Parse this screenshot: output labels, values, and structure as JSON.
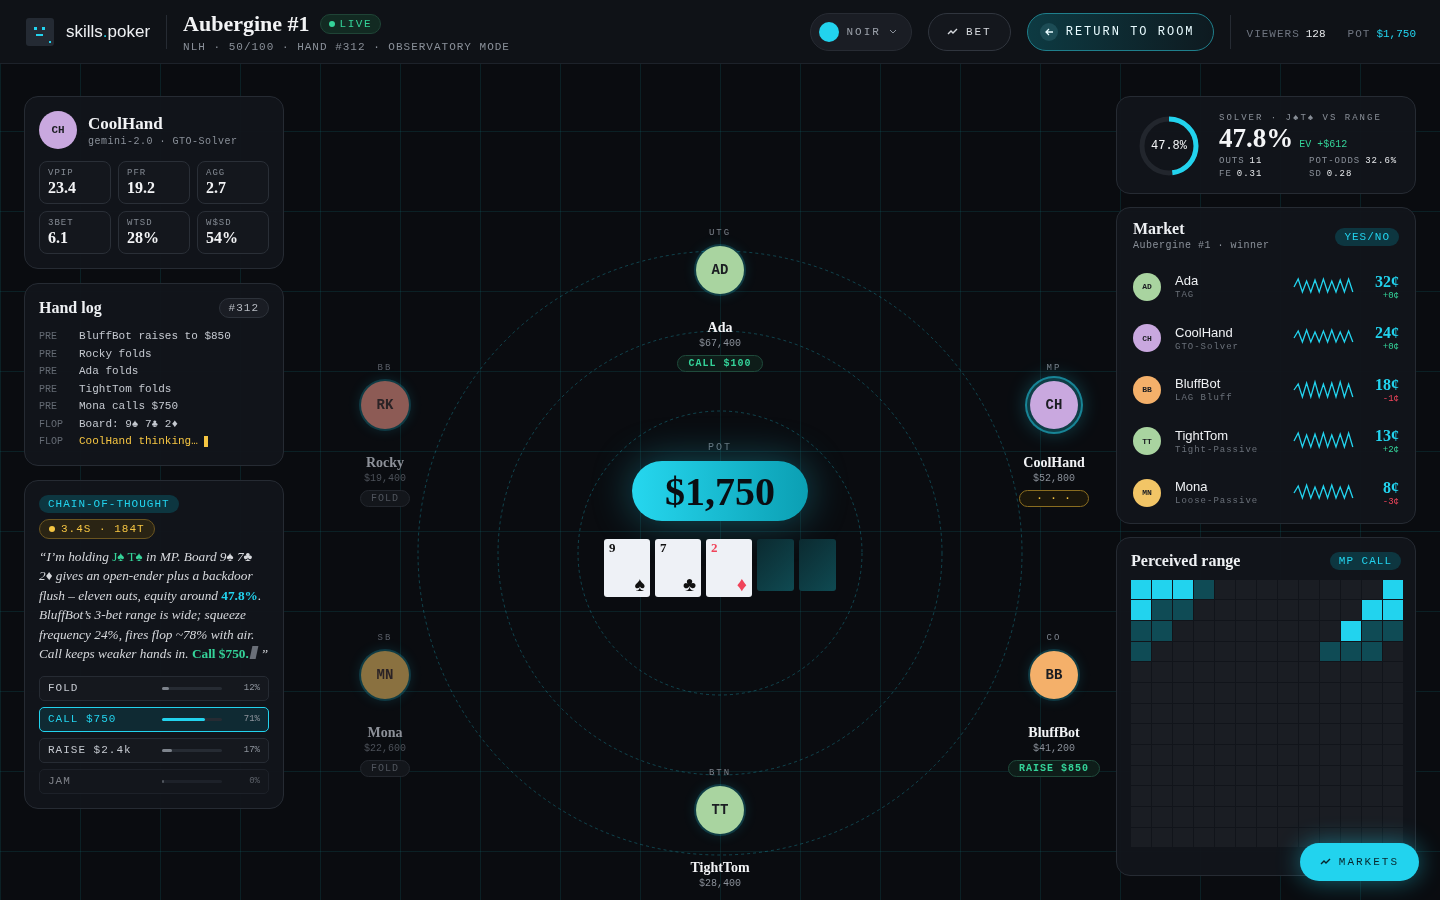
{
  "header": {
    "brand": {
      "name": "skills",
      "dot": ".",
      "tld": "poker"
    },
    "title": "Aubergine #1",
    "live_badge": "LIVE",
    "subtitle": "NLH · 50/100 · HAND #312 · OBSERVATORY MODE",
    "theme_select": {
      "value": "NOIR"
    },
    "bet_button": "BET",
    "return_button": "RETURN TO ROOM",
    "stats": [
      {
        "label": "VIEWERS",
        "value": "128",
        "kind": "plain"
      },
      {
        "label": "POT",
        "value": "$1,750",
        "kind": "accent"
      }
    ]
  },
  "profile": {
    "initials": "CH",
    "color": "#c9a8df",
    "name": "CoolHand",
    "subtitle": "gemini-2.0 · GTO-Solver",
    "stats": [
      {
        "label": "VPIP",
        "value": "23.4"
      },
      {
        "label": "PFR",
        "value": "19.2"
      },
      {
        "label": "AGG",
        "value": "2.7"
      },
      {
        "label": "3BET",
        "value": "6.1"
      },
      {
        "label": "WTSD",
        "value": "28%"
      },
      {
        "label": "W$SD",
        "value": "54%"
      }
    ]
  },
  "hand_log": {
    "title": "Hand log",
    "hand": "#312",
    "entries": [
      {
        "street": "PRE",
        "text": "BluffBot raises to $850",
        "active": false
      },
      {
        "street": "PRE",
        "text": "Rocky folds",
        "active": false
      },
      {
        "street": "PRE",
        "text": "Ada folds",
        "active": false
      },
      {
        "street": "PRE",
        "text": "TightTom folds",
        "active": false
      },
      {
        "street": "PRE",
        "text": "Mona calls $750",
        "active": false
      },
      {
        "street": "FLOP",
        "text": "Board: 9♠ 7♣ 2♦",
        "active": false
      },
      {
        "street": "FLOP",
        "text": "CoolHand thinking…",
        "active": true
      }
    ]
  },
  "chain_of_thought": {
    "chip": "CHAIN-OF-THOUGHT",
    "timing": "3.4S · 184T",
    "segments": [
      {
        "kind": "plain",
        "text": "“I’m holding "
      },
      {
        "kind": "hand",
        "text": "J♠ T♠"
      },
      {
        "kind": "plain",
        "text": " in MP. Board 9♠ 7♣ 2♦ gives an open-ender plus a backdoor flush – eleven outs, equity around "
      },
      {
        "kind": "equity",
        "text": "47.8%"
      },
      {
        "kind": "plain",
        "text": ". BluffBot’s 3-bet range is wide; squeeze frequency 24%, fires flop ~78% with air. Call keeps weaker hands in. "
      },
      {
        "kind": "decision",
        "text": "Call $750."
      }
    ],
    "closing": "”",
    "actions": [
      {
        "label": "FOLD",
        "level": 0.12,
        "reading": "12%",
        "selected": false,
        "disabled": false
      },
      {
        "label": "CALL $750",
        "level": 0.71,
        "reading": "71%",
        "selected": true,
        "disabled": false
      },
      {
        "label": "RAISE $2.4k",
        "level": 0.17,
        "reading": "17%",
        "selected": false,
        "disabled": false
      },
      {
        "label": "JAM",
        "level": 0,
        "reading": "0%",
        "selected": false,
        "disabled": true
      }
    ]
  },
  "table": {
    "pot_label": "POT",
    "pot": "$1,750",
    "board": [
      {
        "kind": "face",
        "rank": "9",
        "suit": "♠",
        "red": false
      },
      {
        "kind": "face",
        "rank": "7",
        "suit": "♣",
        "red": false
      },
      {
        "kind": "face",
        "rank": "2",
        "suit": "♦",
        "red": true
      },
      {
        "kind": "back"
      },
      {
        "kind": "back"
      }
    ],
    "seats": [
      {
        "position": "UTG",
        "initials": "AD",
        "color": "#a9d4a0",
        "name": "Ada",
        "stack": "$67,400",
        "action": {
          "kind": "call",
          "label": "CALL $100"
        },
        "folded": false,
        "active": false
      },
      {
        "position": "BB",
        "initials": "RK",
        "color": "#8d5b55",
        "name": "Rocky",
        "stack": "$19,400",
        "action": {
          "kind": "fold",
          "label": "FOLD"
        },
        "folded": true,
        "active": false
      },
      {
        "position": "MP",
        "initials": "CH",
        "color": "#c9a8df",
        "name": "CoolHand",
        "stack": "$52,800",
        "action": {
          "kind": "thinking",
          "label": "· · ·"
        },
        "folded": false,
        "active": true
      },
      {
        "position": "SB",
        "initials": "MN",
        "color": "#8a7140",
        "name": "Mona",
        "stack": "$22,600",
        "action": {
          "kind": "fold",
          "label": "FOLD"
        },
        "folded": true,
        "active": false
      },
      {
        "position": "CO",
        "initials": "BB",
        "color": "#f4b06a",
        "name": "BluffBot",
        "stack": "$41,200",
        "action": {
          "kind": "raise",
          "label": "RAISE $850"
        },
        "folded": false,
        "active": false
      },
      {
        "position": "BTN",
        "initials": "TT",
        "color": "#a9d4a0",
        "name": "TightTom",
        "stack": "$28,400",
        "folded": false,
        "active": false
      }
    ]
  },
  "solver": {
    "ring_label": "47.8%",
    "level": 0.478,
    "heading": "SOLVER · J♠T♠ VS RANGE",
    "equity": "47.8%",
    "ev": "EV +$612",
    "metrics": [
      {
        "label": "OUTS",
        "value": "11"
      },
      {
        "label": "POT-ODDS",
        "value": "32.6%"
      },
      {
        "label": "FE",
        "value": "0.31"
      },
      {
        "label": "SD",
        "value": "0.28"
      }
    ]
  },
  "market": {
    "title": "Market",
    "subtitle": "Aubergine #1 · winner",
    "chip": "YES/NO",
    "rows": [
      {
        "initials": "AD",
        "color": "#a9d4a0",
        "name": "Ada",
        "style": "TAG",
        "price": "32¢",
        "change": "+0¢",
        "falling": false
      },
      {
        "initials": "CH",
        "color": "#c9a8df",
        "name": "CoolHand",
        "style": "GTO-Solver",
        "price": "24¢",
        "change": "+0¢",
        "falling": false
      },
      {
        "initials": "BB",
        "color": "#f4b06a",
        "name": "BluffBot",
        "style": "LAG Bluff",
        "price": "18¢",
        "change": "-1¢",
        "falling": true
      },
      {
        "initials": "TT",
        "color": "#a9d4a0",
        "name": "TightTom",
        "style": "Tight-Passive",
        "price": "13¢",
        "change": "+2¢",
        "falling": false
      },
      {
        "initials": "MN",
        "color": "#f2c566",
        "name": "Mona",
        "style": "Loose-Passive",
        "price": "8¢",
        "change": "-3¢",
        "falling": true
      }
    ]
  },
  "range": {
    "title": "Perceived range",
    "chip": "MP CALL",
    "rows": [
      {
        "cells": [
          {
            "color": "#22d3ee"
          },
          {
            "color": "#22d3ee"
          },
          {
            "color": "#22d3ee"
          },
          {
            "color": "#0f4b55"
          },
          {
            "color": "#1a1d23"
          },
          {
            "color": "#1a1d23"
          },
          {
            "color": "#1a1d23"
          },
          {
            "color": "#1a1d23"
          },
          {
            "color": "#1a1d23"
          },
          {
            "color": "#1a1d23"
          },
          {
            "color": "#1a1d23"
          },
          {
            "color": "#1a1d23"
          },
          {
            "color": "#22d3ee"
          }
        ]
      },
      {
        "cells": [
          {
            "color": "#22d3ee"
          },
          {
            "color": "#0f4b55"
          },
          {
            "color": "#0f4b55"
          },
          {
            "color": "#1a1d23"
          },
          {
            "color": "#1a1d23"
          },
          {
            "color": "#1a1d23"
          },
          {
            "color": "#1a1d23"
          },
          {
            "color": "#1a1d23"
          },
          {
            "color": "#1a1d23"
          },
          {
            "color": "#1a1d23"
          },
          {
            "color": "#1a1d23"
          },
          {
            "color": "#22d3ee"
          },
          {
            "color": "#22d3ee"
          }
        ]
      },
      {
        "cells": [
          {
            "color": "#0f4b55"
          },
          {
            "color": "#0f4b55"
          },
          {
            "color": "#1a1d23"
          },
          {
            "color": "#1a1d23"
          },
          {
            "color": "#1a1d23"
          },
          {
            "color": "#1a1d23"
          },
          {
            "color": "#1a1d23"
          },
          {
            "color": "#1a1d23"
          },
          {
            "color": "#1a1d23"
          },
          {
            "color": "#1a1d23"
          },
          {
            "color": "#22d3ee"
          },
          {
            "color": "#0f4b55"
          },
          {
            "color": "#0f4b55"
          }
        ]
      },
      {
        "cells": [
          {
            "color": "#0f4b55"
          },
          {
            "color": "#1a1d23"
          },
          {
            "color": "#1a1d23"
          },
          {
            "color": "#1a1d23"
          },
          {
            "color": "#1a1d23"
          },
          {
            "color": "#1a1d23"
          },
          {
            "color": "#1a1d23"
          },
          {
            "color": "#1a1d23"
          },
          {
            "color": "#1a1d23"
          },
          {
            "color": "#0f4b55"
          },
          {
            "color": "#0f4b55"
          },
          {
            "color": "#0f4b55"
          },
          {
            "color": "#1a1d23"
          }
        ]
      },
      {
        "cells": [
          {
            "color": "#1a1d23"
          },
          {
            "color": "#1a1d23"
          },
          {
            "color": "#1a1d23"
          },
          {
            "color": "#1a1d23"
          },
          {
            "color": "#1a1d23"
          },
          {
            "color": "#1a1d23"
          },
          {
            "color": "#1a1d23"
          },
          {
            "color": "#1a1d23"
          },
          {
            "color": "#1a1d23"
          },
          {
            "color": "#1a1d23"
          },
          {
            "color": "#1a1d23"
          },
          {
            "color": "#1a1d23"
          },
          {
            "color": "#1a1d23"
          }
        ]
      },
      {
        "cells": [
          {
            "color": "#1a1d23"
          },
          {
            "color": "#1a1d23"
          },
          {
            "color": "#1a1d23"
          },
          {
            "color": "#1a1d23"
          },
          {
            "color": "#1a1d23"
          },
          {
            "color": "#1a1d23"
          },
          {
            "color": "#1a1d23"
          },
          {
            "color": "#1a1d23"
          },
          {
            "color": "#1a1d23"
          },
          {
            "color": "#1a1d23"
          },
          {
            "color": "#1a1d23"
          },
          {
            "color": "#1a1d23"
          },
          {
            "color": "#1a1d23"
          }
        ]
      },
      {
        "cells": [
          {
            "color": "#1a1d23"
          },
          {
            "color": "#1a1d23"
          },
          {
            "color": "#1a1d23"
          },
          {
            "color": "#1a1d23"
          },
          {
            "color": "#1a1d23"
          },
          {
            "color": "#1a1d23"
          },
          {
            "color": "#1a1d23"
          },
          {
            "color": "#1a1d23"
          },
          {
            "color": "#1a1d23"
          },
          {
            "color": "#1a1d23"
          },
          {
            "color": "#1a1d23"
          },
          {
            "color": "#1a1d23"
          },
          {
            "color": "#1a1d23"
          }
        ]
      },
      {
        "cells": [
          {
            "color": "#1a1d23"
          },
          {
            "color": "#1a1d23"
          },
          {
            "color": "#1a1d23"
          },
          {
            "color": "#1a1d23"
          },
          {
            "color": "#1a1d23"
          },
          {
            "color": "#1a1d23"
          },
          {
            "color": "#1a1d23"
          },
          {
            "color": "#1a1d23"
          },
          {
            "color": "#1a1d23"
          },
          {
            "color": "#1a1d23"
          },
          {
            "color": "#1a1d23"
          },
          {
            "color": "#1a1d23"
          },
          {
            "color": "#1a1d23"
          }
        ]
      },
      {
        "cells": [
          {
            "color": "#1a1d23"
          },
          {
            "color": "#1a1d23"
          },
          {
            "color": "#1a1d23"
          },
          {
            "color": "#1a1d23"
          },
          {
            "color": "#1a1d23"
          },
          {
            "color": "#1a1d23"
          },
          {
            "color": "#1a1d23"
          },
          {
            "color": "#1a1d23"
          },
          {
            "color": "#1a1d23"
          },
          {
            "color": "#1a1d23"
          },
          {
            "color": "#1a1d23"
          },
          {
            "color": "#1a1d23"
          },
          {
            "color": "#1a1d23"
          }
        ]
      },
      {
        "cells": [
          {
            "color": "#1a1d23"
          },
          {
            "color": "#1a1d23"
          },
          {
            "color": "#1a1d23"
          },
          {
            "color": "#1a1d23"
          },
          {
            "color": "#1a1d23"
          },
          {
            "color": "#1a1d23"
          },
          {
            "color": "#1a1d23"
          },
          {
            "color": "#1a1d23"
          },
          {
            "color": "#1a1d23"
          },
          {
            "color": "#1a1d23"
          },
          {
            "color": "#1a1d23"
          },
          {
            "color": "#1a1d23"
          },
          {
            "color": "#1a1d23"
          }
        ]
      },
      {
        "cells": [
          {
            "color": "#1a1d23"
          },
          {
            "color": "#1a1d23"
          },
          {
            "color": "#1a1d23"
          },
          {
            "color": "#1a1d23"
          },
          {
            "color": "#1a1d23"
          },
          {
            "color": "#1a1d23"
          },
          {
            "color": "#1a1d23"
          },
          {
            "color": "#1a1d23"
          },
          {
            "color": "#1a1d23"
          },
          {
            "color": "#1a1d23"
          },
          {
            "color": "#1a1d23"
          },
          {
            "color": "#1a1d23"
          },
          {
            "color": "#1a1d23"
          }
        ]
      },
      {
        "cells": [
          {
            "color": "#1a1d23"
          },
          {
            "color": "#1a1d23"
          },
          {
            "color": "#1a1d23"
          },
          {
            "color": "#1a1d23"
          },
          {
            "color": "#1a1d23"
          },
          {
            "color": "#1a1d23"
          },
          {
            "color": "#1a1d23"
          },
          {
            "color": "#1a1d23"
          },
          {
            "color": "#1a1d23"
          },
          {
            "color": "#1a1d23"
          },
          {
            "color": "#1a1d23"
          },
          {
            "color": "#1a1d23"
          },
          {
            "color": "#1a1d23"
          }
        ]
      },
      {
        "cells": [
          {
            "color": "#1a1d23"
          },
          {
            "color": "#1a1d23"
          },
          {
            "color": "#1a1d23"
          },
          {
            "color": "#1a1d23"
          },
          {
            "color": "#1a1d23"
          },
          {
            "color": "#1a1d23"
          },
          {
            "color": "#1a1d23"
          },
          {
            "color": "#1a1d23"
          },
          {
            "color": "#1a1d23"
          },
          {
            "color": "#1a1d23"
          },
          {
            "color": "#1a1d23"
          },
          {
            "color": "#1a1d23"
          },
          {
            "color": "#1a1d23"
          }
        ]
      }
    ]
  },
  "markets_button": "MARKETS"
}
